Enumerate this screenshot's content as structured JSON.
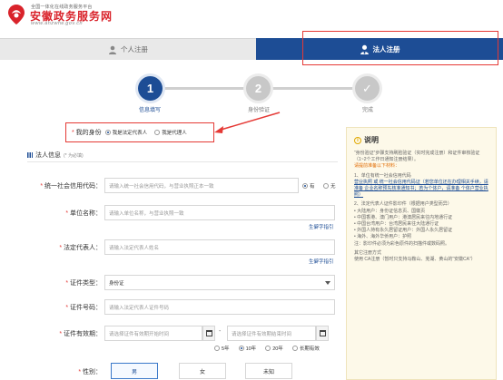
{
  "header": {
    "tagline": "全国一体化在线政务服务平台",
    "site_name": "安徽政务服务网",
    "url": "www.ahzwfw.gov.cn"
  },
  "tabs": {
    "personal": "个人注册",
    "legal": "法人注册"
  },
  "steps": [
    {
      "num": "1",
      "label": "信息填写"
    },
    {
      "num": "2",
      "label": "身份验证"
    },
    {
      "num": "✓",
      "label": "完成"
    }
  ],
  "identity": {
    "label": "我的身份",
    "option_legal": "我是法定代表人",
    "option_agent": "我是代理人"
  },
  "section": {
    "title": "法人信息",
    "note": "(* 为必填)"
  },
  "form": {
    "credit_code": {
      "label": "统一社会信用代码：",
      "placeholder": "请输入统一社会信用代码，与营业执照正本一致",
      "opt_yes": "有",
      "opt_no": "无"
    },
    "unit_name": {
      "label": "单位名称：",
      "placeholder": "请输入单位名称，与营业执照一致"
    },
    "legal_rep": {
      "label": "法定代表人：",
      "placeholder": "请输入法定代表人姓名"
    },
    "fill_guide": "生僻字指引",
    "cert_type": {
      "label": "证件类型：",
      "value": "身份证"
    },
    "cert_no": {
      "label": "证件号码：",
      "placeholder": "请输入法定代表人证件号码"
    },
    "validity": {
      "label": "证件有效期：",
      "start_placeholder": "请选择证件有效期开始时间",
      "end_placeholder": "请选择证件有效期结束时间",
      "dash": "-",
      "options": [
        "5年",
        "10年",
        "20年",
        "长期有效"
      ]
    },
    "gender": {
      "label": "性别：",
      "options": [
        "男",
        "女",
        "未知"
      ]
    }
  },
  "side": {
    "title": "说明",
    "p1": "“身份验证”步骤支持刷脸验证（实时完成注册）和证件审核验证（1~2个工作日通知注册结果）。",
    "p1_warn": "请提前准备以下材料：",
    "p2": "1、单位有统一社会信用代码",
    "p2_detail": "营业执照 或 统一社会信用代码证（若您单位还在办理相关手续，请准备 企业名称预先核准通知书；若为个体户，请准备 个体户营业执照）",
    "p3": "2、法定代表人证件影印件（根据用户类型而异）",
    "p3_items": [
      "大陆用户：身份证信息页、国徽页",
      "中国香港、澳门用户：港澳居民来往内地通行证",
      "中国台湾用户：台湾居民来往大陆通行证",
      "外国人持有永久居留证用户：外国人永久居留证",
      "海外、海外华侨用户：护照"
    ],
    "p3_note": "注：影印件必须为彩色原件的扫描件或数码照。",
    "p4": "其它注册方式",
    "p4_detail": "使用 CA注册（暂时只支持马鞍山、芜湖、黄山的“安徽CA”）"
  },
  "colors": {
    "brand_red": "#d9232b",
    "nav_blue": "#1d4d95",
    "step_active": "#1d4d95",
    "step_inactive": "#c8c8c8",
    "annotation_red": "#e53935"
  }
}
